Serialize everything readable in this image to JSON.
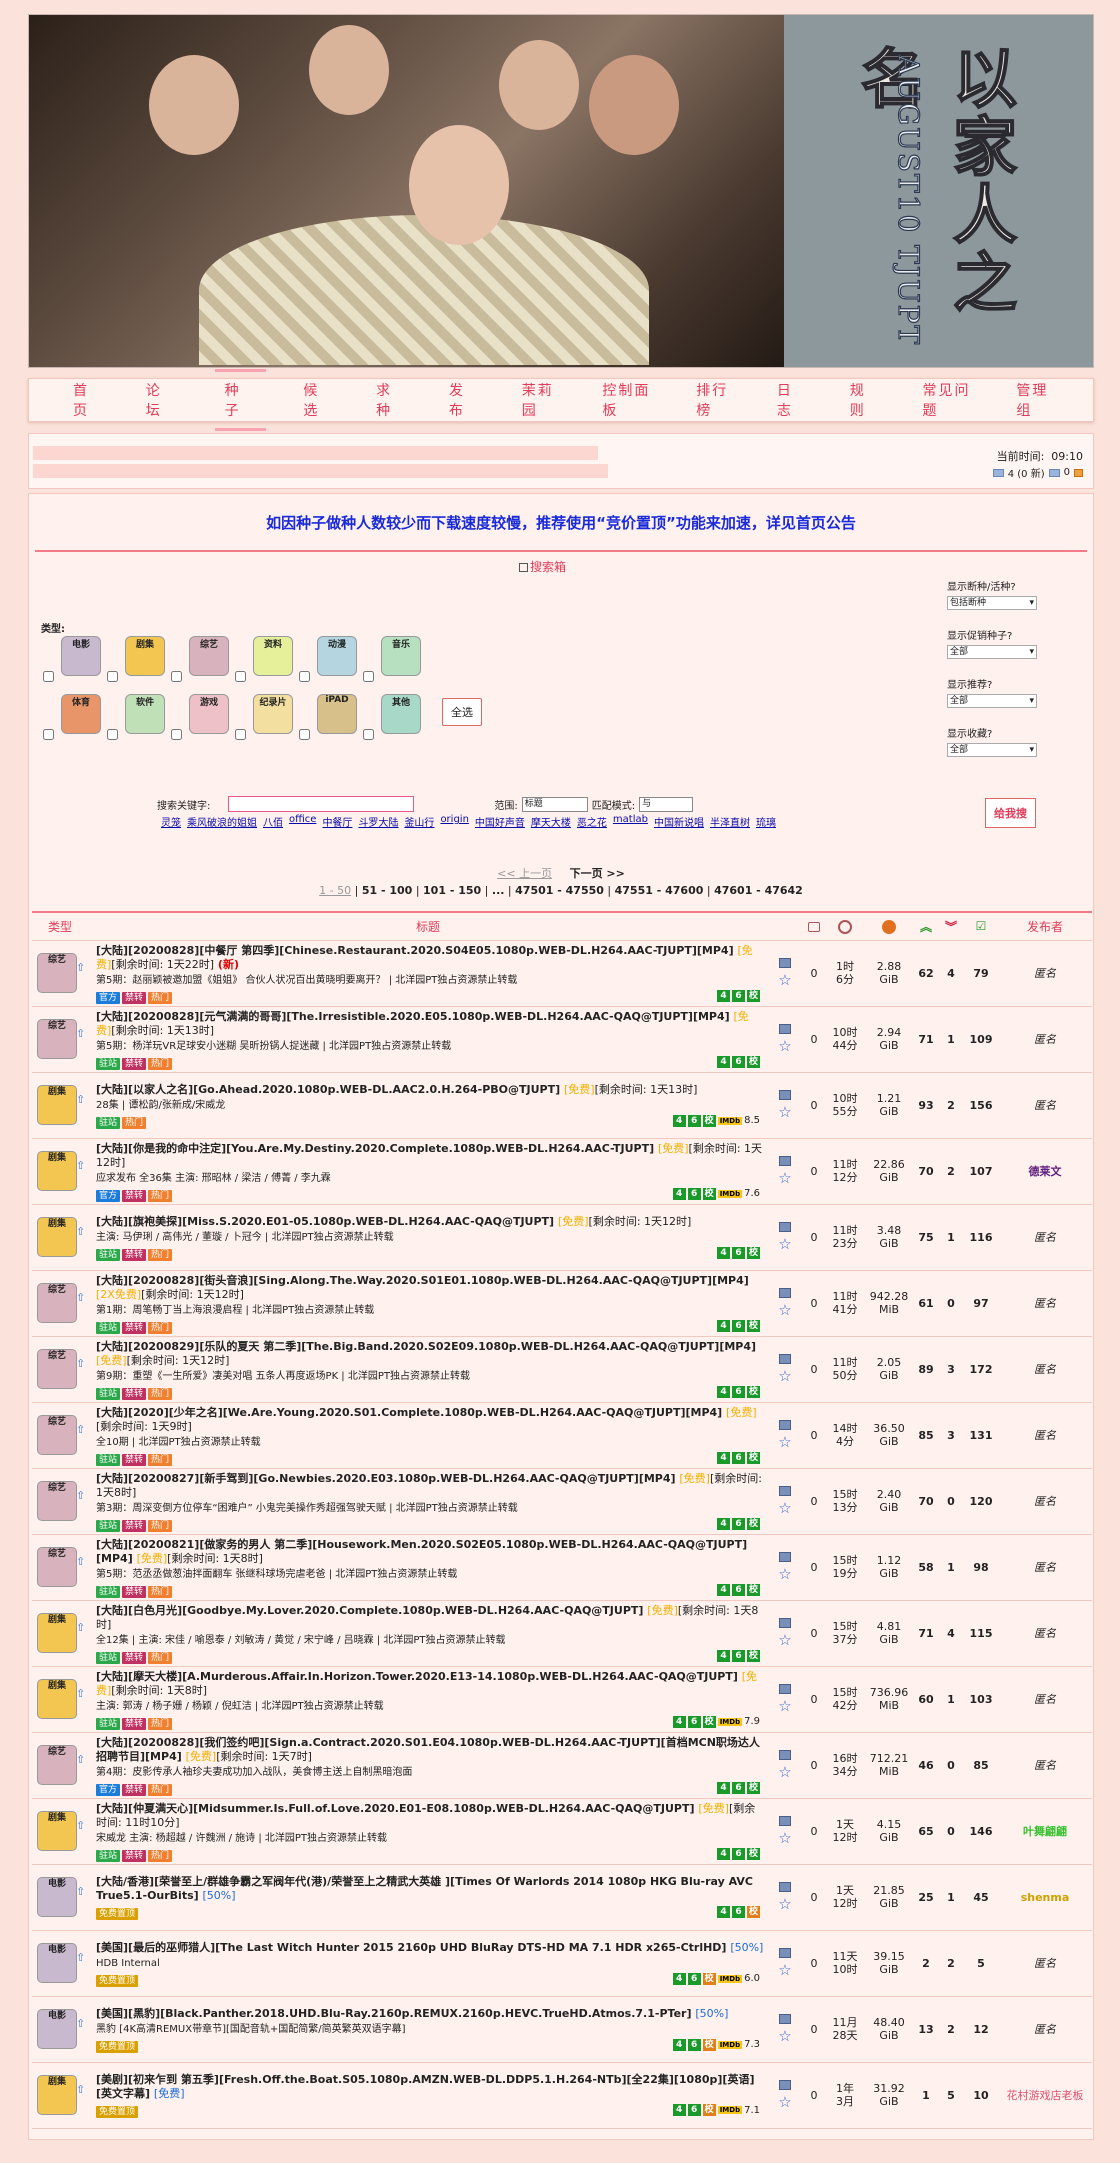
{
  "banner": {
    "title_cn": "以家人之名",
    "title_en": "AUGUST10 TJUPT"
  },
  "nav": [
    "首 页",
    "论 坛",
    "种 子",
    "候 选",
    "求 种",
    "发 布",
    "茉莉园",
    "控制面板",
    "排行榜",
    "日 志",
    "规 则",
    "常见问题",
    "管理组"
  ],
  "status": {
    "time_label": "当前时间:",
    "time": "09:10",
    "messages": "4 (0 新)",
    "inbox": "0"
  },
  "notice": "如因种子做种人数较少而下载速度较慢，推荐使用“竞价置顶”功能来加速，详见首页公告",
  "search": {
    "title": "搜索箱",
    "type_label": "类型:",
    "categories": [
      "电影",
      "剧集",
      "综艺",
      "资料",
      "动漫",
      "音乐",
      "体育",
      "软件",
      "游戏",
      "纪录片",
      "iPAD",
      "其他"
    ],
    "select_all": "全选",
    "filters": [
      {
        "label": "显示断种/活种?",
        "value": "包括断种"
      },
      {
        "label": "显示促销种子?",
        "value": "全部"
      },
      {
        "label": "显示推荐?",
        "value": "全部"
      },
      {
        "label": "显示收藏?",
        "value": "全部"
      }
    ],
    "keyword_label": "搜索关键字:",
    "scope_label": "范围:",
    "scope_value": "标题",
    "match_label": "匹配模式:",
    "match_value": "与",
    "go": "给我搜",
    "hot": [
      "灵笼",
      "乘风破浪的姐姐",
      "八佰",
      "office",
      "中餐厅",
      "斗罗大陆",
      "釜山行",
      "origin",
      "中国好声音",
      "摩天大楼",
      "恶之花",
      "matlab",
      "中国新说唱",
      "半泽直树",
      "琉璃"
    ]
  },
  "pager": {
    "prev": "<< 上一页",
    "next": "下一页 >>",
    "pages": [
      "1 - 50",
      "51 - 100",
      "101 - 150",
      "...",
      "47501 - 47550",
      "47551 - 47600",
      "47601 - 47642"
    ]
  },
  "table": {
    "headers": [
      "类型",
      "标题",
      "",
      "",
      "",
      "",
      "",
      "",
      "发布者"
    ],
    "rows": [
      {
        "cat": "综艺",
        "name": "[大陆][20200828][中餐厅 第四季][Chinese.Restaurant.2020.S04E05.1080p.WEB-DL.H264.AAC-TJUPT][MP4]",
        "free": "[免费]",
        "rem": "[剩余时间: 1天22时]",
        "new": "(新)",
        "sub": "第5期：赵丽颖被邀加盟《姐姐》 合伙人状况百出黄晓明要离开？ | 北洋园PT独占资源禁止转载",
        "tags": [
          "官方",
          "禁转",
          "热门"
        ],
        "comments": "0",
        "ttl": "1时\n6分",
        "size": "2.88\nGiB",
        "seed": "62",
        "leech": "4",
        "done": "79",
        "uploader": "匿名",
        "imdb": ""
      },
      {
        "cat": "综艺",
        "name": "[大陆][20200828][元气满满的哥哥][The.Irresistible.2020.E05.1080p.WEB-DL.H264.AAC-QAQ@TJUPT][MP4]",
        "free": "[免费]",
        "rem": "[剩余时间: 1天13时]",
        "new": "",
        "sub": "第5期：杨洋玩VR足球安小迷糊 吴昕扮锅人捉迷藏 | 北洋园PT独占资源禁止转载",
        "tags": [
          "驻站",
          "禁转",
          "热门"
        ],
        "comments": "0",
        "ttl": "10时\n44分",
        "size": "2.94\nGiB",
        "seed": "71",
        "leech": "1",
        "done": "109",
        "uploader": "匿名",
        "imdb": ""
      },
      {
        "cat": "剧集",
        "name": "[大陆][以家人之名][Go.Ahead.2020.1080p.WEB-DL.AAC2.0.H.264-PBO@TJUPT]",
        "free": "[免费]",
        "rem": "[剩余时间: 1天13时]",
        "new": "",
        "sub": "28集 | 谭松韵/张新成/宋威龙",
        "tags": [
          "驻站",
          "热门"
        ],
        "comments": "0",
        "ttl": "10时\n55分",
        "size": "1.21\nGiB",
        "seed": "93",
        "leech": "2",
        "done": "156",
        "uploader": "匿名",
        "imdb": "8.5"
      },
      {
        "cat": "剧集",
        "name": "[大陆][你是我的命中注定][You.Are.My.Destiny.2020.Complete.1080p.WEB-DL.H264.AAC-TJUPT]",
        "free": "[免费]",
        "rem": "[剩余时间: 1天12时]",
        "new": "",
        "sub": "应求发布 全36集 主演: 邢昭林 / 梁洁 / 傅菁 / 李九霖",
        "tags": [
          "官方",
          "禁转",
          "热门"
        ],
        "comments": "0",
        "ttl": "11时\n12分",
        "size": "22.86\nGiB",
        "seed": "70",
        "leech": "2",
        "done": "107",
        "uploader": "德莱文",
        "imdb": "7.6"
      },
      {
        "cat": "剧集",
        "name": "[大陆][旗袍美探][Miss.S.2020.E01-05.1080p.WEB-DL.H264.AAC-QAQ@TJUPT]",
        "free": "[免费]",
        "rem": "[剩余时间: 1天12时]",
        "new": "",
        "sub": "主演: 马伊琍 / 高伟光 / 董璇 / 卜冠今 | 北洋园PT独占资源禁止转载",
        "tags": [
          "驻站",
          "禁转",
          "热门"
        ],
        "comments": "0",
        "ttl": "11时\n23分",
        "size": "3.48\nGiB",
        "seed": "75",
        "leech": "1",
        "done": "116",
        "uploader": "匿名",
        "imdb": ""
      },
      {
        "cat": "综艺",
        "name": "[大陆][20200828][街头音浪][Sing.Along.The.Way.2020.S01E01.1080p.WEB-DL.H264.AAC-QAQ@TJUPT][MP4]",
        "free": "[2X免费]",
        "rem": "[剩余时间: 1天12时]",
        "new": "",
        "sub": "第1期：周笔畅丁当上海浪漫启程 | 北洋园PT独占资源禁止转载",
        "tags": [
          "驻站",
          "禁转",
          "热门"
        ],
        "comments": "0",
        "ttl": "11时\n41分",
        "size": "942.28\nMiB",
        "seed": "61",
        "leech": "0",
        "done": "97",
        "uploader": "匿名",
        "imdb": ""
      },
      {
        "cat": "综艺",
        "name": "[大陆][20200829][乐队的夏天 第二季][The.Big.Band.2020.S02E09.1080p.WEB-DL.H264.AAC-QAQ@TJUPT][MP4]",
        "free": "[免费]",
        "rem": "[剩余时间: 1天12时]",
        "new": "",
        "sub": "第9期：重塑《一生所爱》凄美对唱 五条人再度返场PK | 北洋园PT独占资源禁止转载",
        "tags": [
          "驻站",
          "禁转",
          "热门"
        ],
        "comments": "0",
        "ttl": "11时\n50分",
        "size": "2.05\nGiB",
        "seed": "89",
        "leech": "3",
        "done": "172",
        "uploader": "匿名",
        "imdb": ""
      },
      {
        "cat": "综艺",
        "name": "[大陆][2020][少年之名][We.Are.Young.2020.S01.Complete.1080p.WEB-DL.H264.AAC-QAQ@TJUPT][MP4]",
        "free": "[免费]",
        "rem": "[剩余时间: 1天9时]",
        "new": "",
        "sub": "全10期 | 北洋园PT独占资源禁止转载",
        "tags": [
          "驻站",
          "禁转",
          "热门"
        ],
        "comments": "0",
        "ttl": "14时\n4分",
        "size": "36.50\nGiB",
        "seed": "85",
        "leech": "3",
        "done": "131",
        "uploader": "匿名",
        "imdb": ""
      },
      {
        "cat": "综艺",
        "name": "[大陆][20200827][新手驾到][Go.Newbies.2020.E03.1080p.WEB-DL.H264.AAC-QAQ@TJUPT][MP4]",
        "free": "[免费]",
        "rem": "[剩余时间: 1天8时]",
        "new": "",
        "sub": "第3期：周深变倒方位停车“困难户” 小鬼完美操作秀超强驾驶天赋 | 北洋园PT独占资源禁止转载",
        "tags": [
          "驻站",
          "禁转",
          "热门"
        ],
        "comments": "0",
        "ttl": "15时\n13分",
        "size": "2.40\nGiB",
        "seed": "70",
        "leech": "0",
        "done": "120",
        "uploader": "匿名",
        "imdb": ""
      },
      {
        "cat": "综艺",
        "name": "[大陆][20200821][做家务的男人 第二季][Housework.Men.2020.S02E05.1080p.WEB-DL.H264.AAC-QAQ@TJUPT][MP4]",
        "free": "[免费]",
        "rem": "[剩余时间: 1天8时]",
        "new": "",
        "sub": "第5期：范丞丞做葱油拌面翻车 张继科球场完虐老爸 | 北洋园PT独占资源禁止转载",
        "tags": [
          "驻站",
          "禁转",
          "热门"
        ],
        "comments": "0",
        "ttl": "15时\n19分",
        "size": "1.12\nGiB",
        "seed": "58",
        "leech": "1",
        "done": "98",
        "uploader": "匿名",
        "imdb": ""
      },
      {
        "cat": "剧集",
        "name": "[大陆][白色月光][Goodbye.My.Lover.2020.Complete.1080p.WEB-DL.H264.AAC-QAQ@TJUPT]",
        "free": "[免费]",
        "rem": "[剩余时间: 1天8时]",
        "new": "",
        "sub": "全12集 | 主演: 宋佳 / 喻恩泰 / 刘敏涛 / 黄觉 / 宋宁峰 / 吕晓霖 | 北洋园PT独占资源禁止转载",
        "tags": [
          "驻站",
          "禁转",
          "热门"
        ],
        "comments": "0",
        "ttl": "15时\n37分",
        "size": "4.81\nGiB",
        "seed": "71",
        "leech": "4",
        "done": "115",
        "uploader": "匿名",
        "imdb": ""
      },
      {
        "cat": "剧集",
        "name": "[大陆][摩天大楼][A.Murderous.Affair.In.Horizon.Tower.2020.E13-14.1080p.WEB-DL.H264.AAC-QAQ@TJUPT]",
        "free": "[免费]",
        "rem": "[剩余时间: 1天8时]",
        "new": "",
        "sub": "主演: 郭涛 / 杨子姗 / 杨颖 / 倪虹洁 | 北洋园PT独占资源禁止转载",
        "tags": [
          "驻站",
          "禁转",
          "热门"
        ],
        "comments": "0",
        "ttl": "15时\n42分",
        "size": "736.96\nMiB",
        "seed": "60",
        "leech": "1",
        "done": "103",
        "uploader": "匿名",
        "imdb": "7.9"
      },
      {
        "cat": "综艺",
        "name": "[大陆][20200828][我们签约吧][Sign.a.Contract.2020.S01.E04.1080p.WEB-DL.H264.AAC-TJUPT][首档MCN职场达人招聘节目][MP4]",
        "free": "[免费]",
        "rem": "[剩余时间: 1天7时]",
        "new": "",
        "sub": "第4期：皮影传承人袖珍夫妻成功加入战队，美食博主送上自制黑暗泡面",
        "tags": [
          "官方",
          "禁转",
          "热门"
        ],
        "comments": "0",
        "ttl": "16时\n34分",
        "size": "712.21\nMiB",
        "seed": "46",
        "leech": "0",
        "done": "85",
        "uploader": "匿名",
        "imdb": ""
      },
      {
        "cat": "剧集",
        "name": "[大陆][仲夏满天心][Midsummer.Is.Full.of.Love.2020.E01-E08.1080p.WEB-DL.H264.AAC-QAQ@TJUPT]",
        "free": "[免费]",
        "rem": "[剩余时间: 11时10分]",
        "new": "",
        "sub": "宋威龙 主演: 杨超越 / 许魏洲 / 施诗 | 北洋园PT独占资源禁止转载",
        "tags": [
          "驻站",
          "禁转",
          "热门"
        ],
        "comments": "0",
        "ttl": "1天\n12时",
        "size": "4.15\nGiB",
        "seed": "65",
        "leech": "0",
        "done": "146",
        "uploader": "叶舞翩翩",
        "imdb": ""
      },
      {
        "cat": "电影",
        "name": "[大陆/香港][荣誉至上/群雄争霸之军阀年代(港)/荣誉至上之精武大英雄 ][Times Of Warlords 2014 1080p HKG Blu-ray AVC True5.1-OurBits]",
        "free": "",
        "rem": "",
        "pct": "[50%]",
        "new": "",
        "sub": "",
        "tags": [
          "免费置顶"
        ],
        "comments": "0",
        "ttl": "1天\n12时",
        "size": "21.85\nGiB",
        "seed": "25",
        "leech": "1",
        "done": "45",
        "uploader": "shenma",
        "imdb": ""
      },
      {
        "cat": "电影",
        "name": "[美国][最后的巫师猎人][The Last Witch Hunter 2015 2160p UHD BluRay DTS-HD MA 7.1 HDR x265-CtrlHD]",
        "free": "",
        "rem": "",
        "pct": "[50%]",
        "new": "",
        "sub": "HDB Internal",
        "tags": [
          "免费置顶"
        ],
        "comments": "0",
        "ttl": "11天\n10时",
        "size": "39.15\nGiB",
        "seed": "2",
        "leech": "2",
        "done": "5",
        "uploader": "匿名",
        "imdb": "6.0"
      },
      {
        "cat": "电影",
        "name": "[美国][黑豹][Black.Panther.2018.UHD.Blu-Ray.2160p.REMUX.2160p.HEVC.TrueHD.Atmos.7.1-PTer]",
        "free": "",
        "rem": "",
        "pct": "[50%]",
        "new": "",
        "sub": "黑豹 [4K高清REMUX带章节][国配音轨+国配简繁/简英繁英双语字幕]",
        "tags": [
          "免费置顶"
        ],
        "comments": "0",
        "ttl": "11月\n28天",
        "size": "48.40\nGiB",
        "seed": "13",
        "leech": "2",
        "done": "12",
        "uploader": "匿名",
        "imdb": "7.3"
      },
      {
        "cat": "剧集",
        "name": "[美剧][初来乍到 第五季][Fresh.Off.the.Boat.S05.1080p.AMZN.WEB-DL.DDP5.1.H.264-NTb][全22集][1080p][英语][英文字幕]",
        "free": "",
        "rem": "",
        "pct": "[免费]",
        "new": "",
        "sub": "",
        "tags": [
          "免费置顶"
        ],
        "comments": "0",
        "ttl": "1年\n3月",
        "size": "31.92\nGiB",
        "seed": "1",
        "leech": "5",
        "done": "10",
        "uploader": "花村游戏店老板",
        "imdb": "7.1"
      }
    ]
  }
}
